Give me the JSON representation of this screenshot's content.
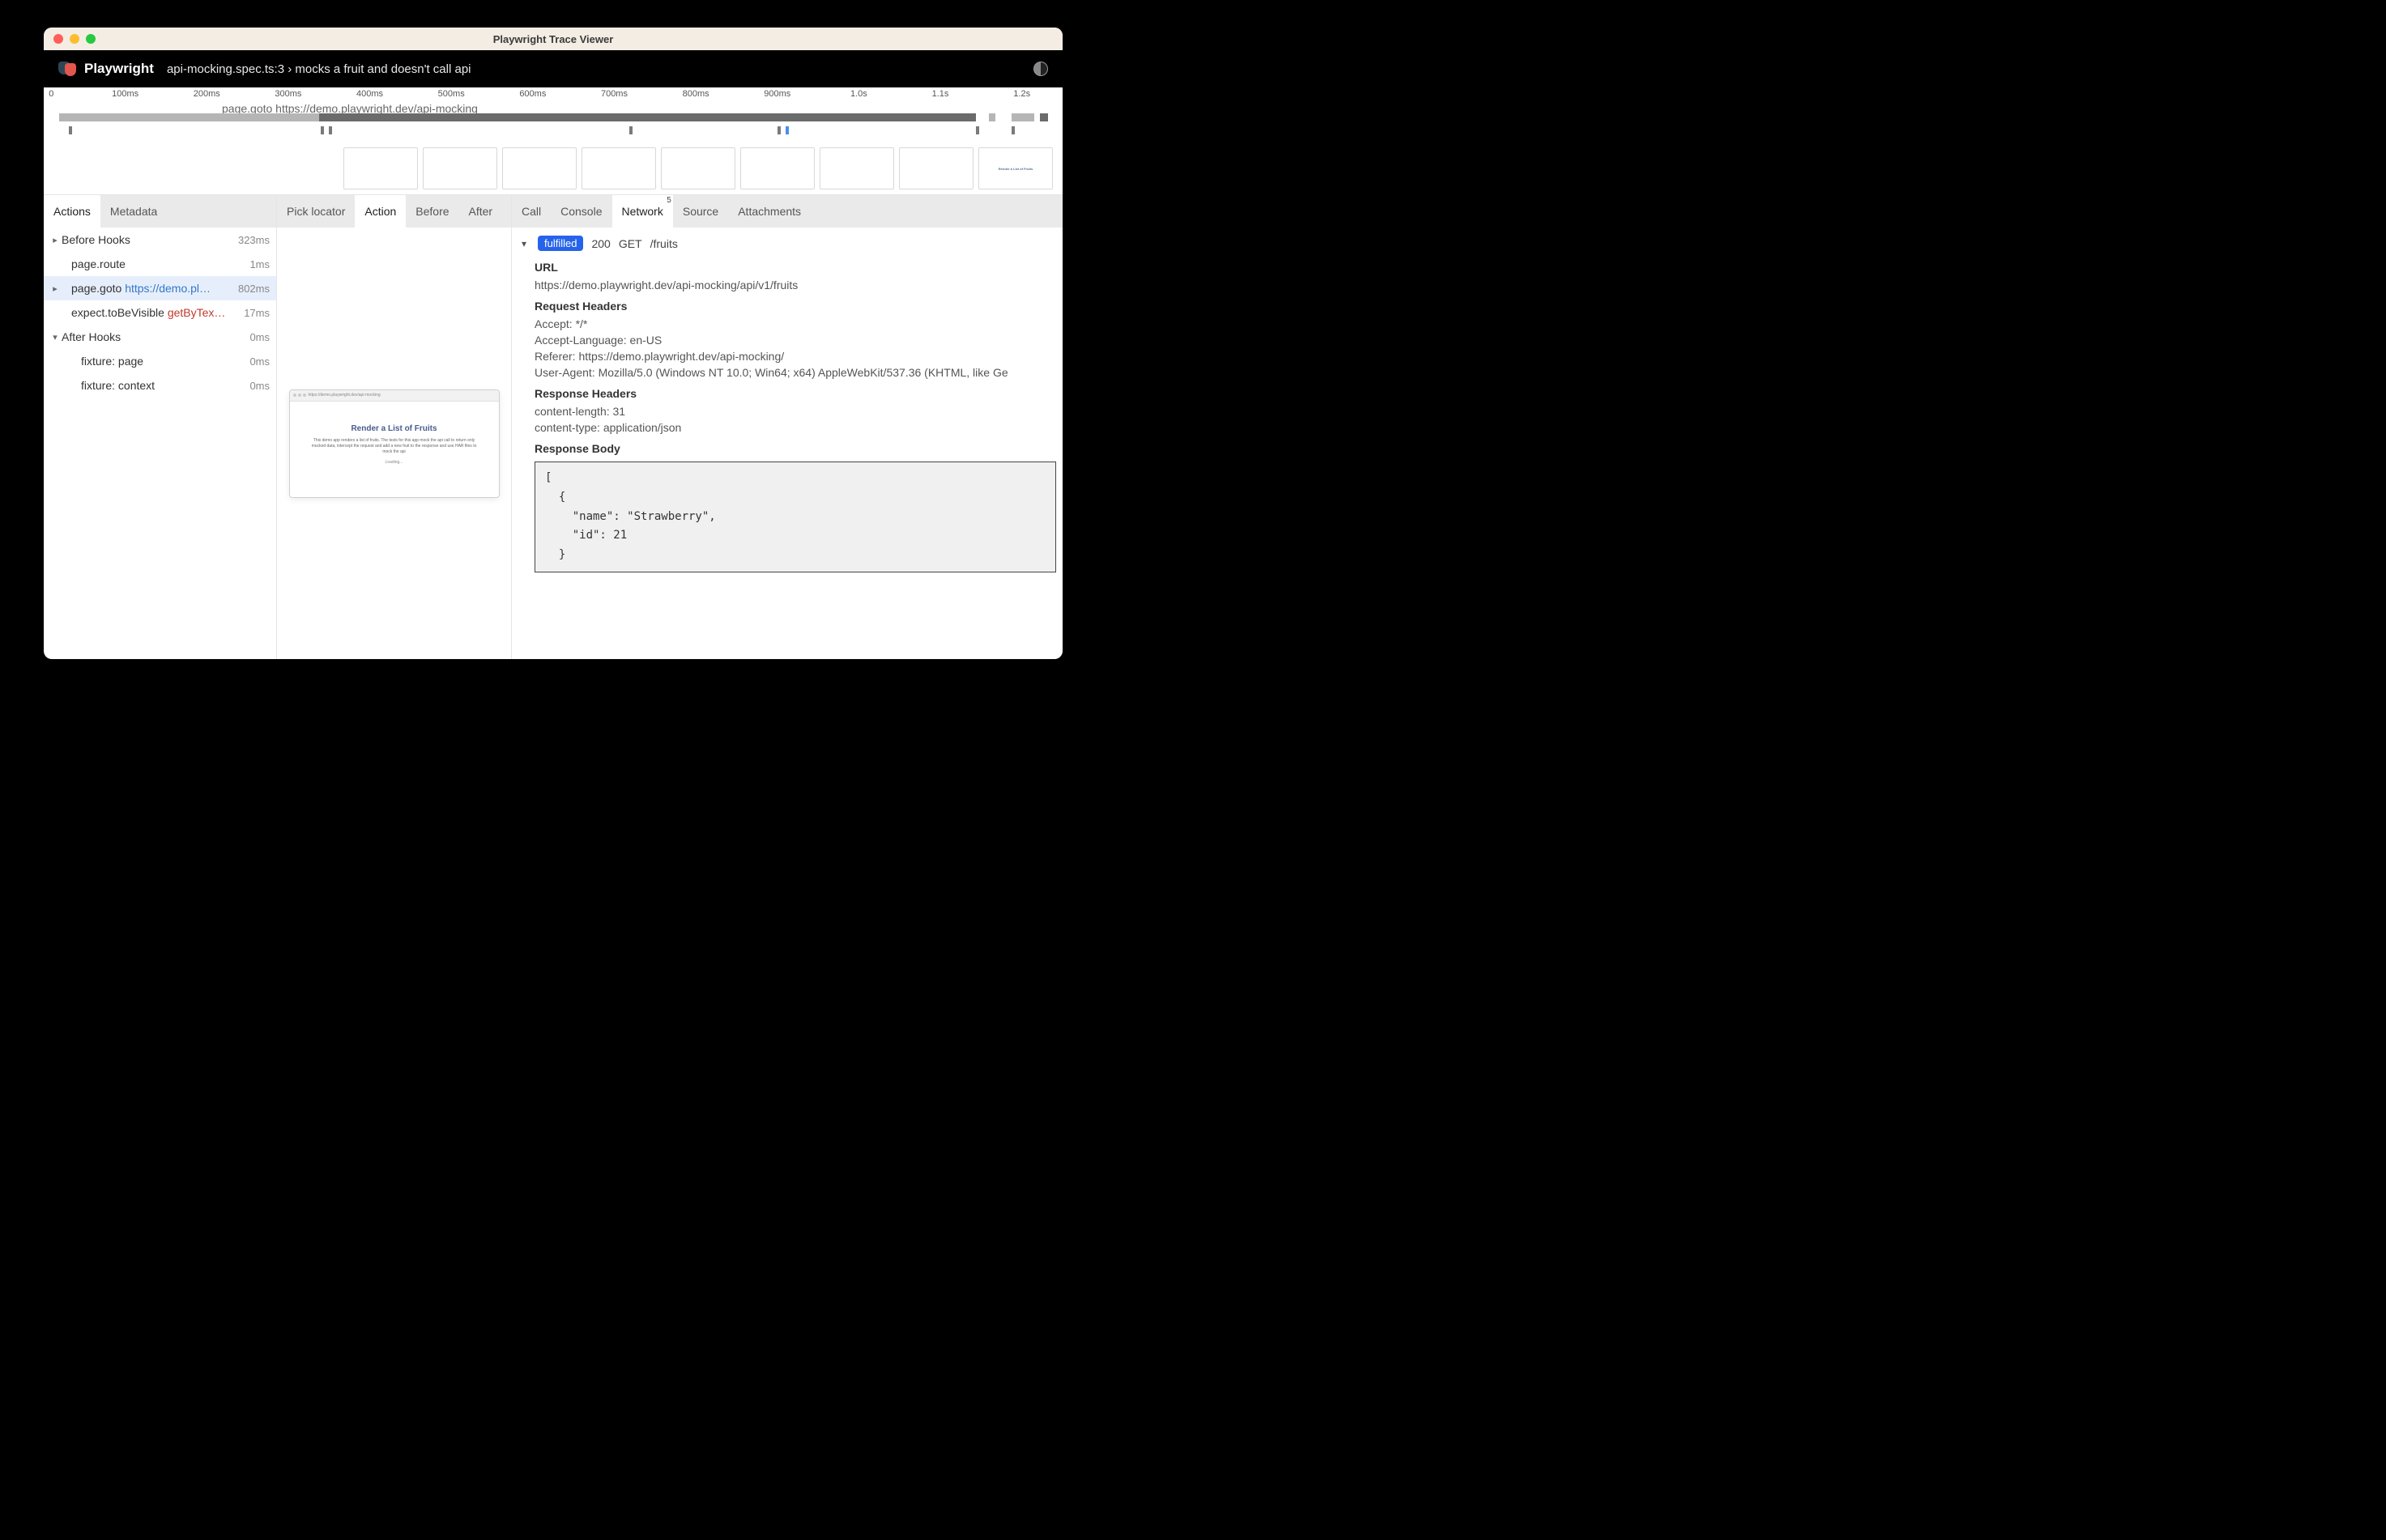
{
  "window": {
    "title": "Playwright Trace Viewer"
  },
  "header": {
    "brand": "Playwright",
    "test_title": "api-mocking.spec.ts:3 › mocks a fruit and doesn't call api"
  },
  "timeline": {
    "ticks": [
      "0",
      "100ms",
      "200ms",
      "300ms",
      "400ms",
      "500ms",
      "600ms",
      "700ms",
      "800ms",
      "900ms",
      "1.0s",
      "1.1s",
      "1.2s"
    ],
    "hover_label": "page.goto https://demo.playwright.dev/api-mocking",
    "filmstrip_last_title": "Render a List of Fruits"
  },
  "left_tabs": [
    "Actions",
    "Metadata"
  ],
  "actions": [
    {
      "chevron": "right",
      "indent": 0,
      "label": "Before Hooks",
      "time": "323ms"
    },
    {
      "chevron": "",
      "indent": 1,
      "label": "page.route",
      "time": "1ms"
    },
    {
      "chevron": "right",
      "indent": 1,
      "label": "page.goto",
      "url": "https://demo.pl…",
      "time": "802ms",
      "selected": true
    },
    {
      "chevron": "",
      "indent": 1,
      "label": "expect.toBeVisible",
      "locator": "getByTex…",
      "time": "17ms"
    },
    {
      "chevron": "down",
      "indent": 0,
      "label": "After Hooks",
      "time": "0ms"
    },
    {
      "chevron": "",
      "indent": 2,
      "label": "fixture: page",
      "time": "0ms"
    },
    {
      "chevron": "",
      "indent": 2,
      "label": "fixture: context",
      "time": "0ms"
    }
  ],
  "mid_tabs": [
    "Pick locator",
    "Action",
    "Before",
    "After"
  ],
  "snapshot": {
    "url": "https://demo.playwright.dev/api-mocking",
    "title": "Render a List of Fruits",
    "desc": "This demo app renders a list of fruits. The tests for this app mock the api call to return only mocked data, intercept the request and add a new fruit to the response and use HAR files to mock the api",
    "loading": "Loading..."
  },
  "right_tabs": [
    {
      "label": "Call"
    },
    {
      "label": "Console"
    },
    {
      "label": "Network",
      "badge": "5",
      "active": true
    },
    {
      "label": "Source"
    },
    {
      "label": "Attachments"
    }
  ],
  "network": {
    "status_text": "fulfilled",
    "status_code": "200",
    "method": "GET",
    "path": "/fruits",
    "url_label": "URL",
    "url": "https://demo.playwright.dev/api-mocking/api/v1/fruits",
    "request_headers_label": "Request Headers",
    "request_headers": [
      "Accept: */*",
      "Accept-Language: en-US",
      "Referer: https://demo.playwright.dev/api-mocking/",
      "User-Agent: Mozilla/5.0 (Windows NT 10.0; Win64; x64) AppleWebKit/537.36 (KHTML, like Ge"
    ],
    "response_headers_label": "Response Headers",
    "response_headers": [
      "content-length: 31",
      "content-type: application/json"
    ],
    "response_body_label": "Response Body",
    "response_body": "[\n  {\n    \"name\": \"Strawberry\",\n    \"id\": 21\n  }"
  }
}
